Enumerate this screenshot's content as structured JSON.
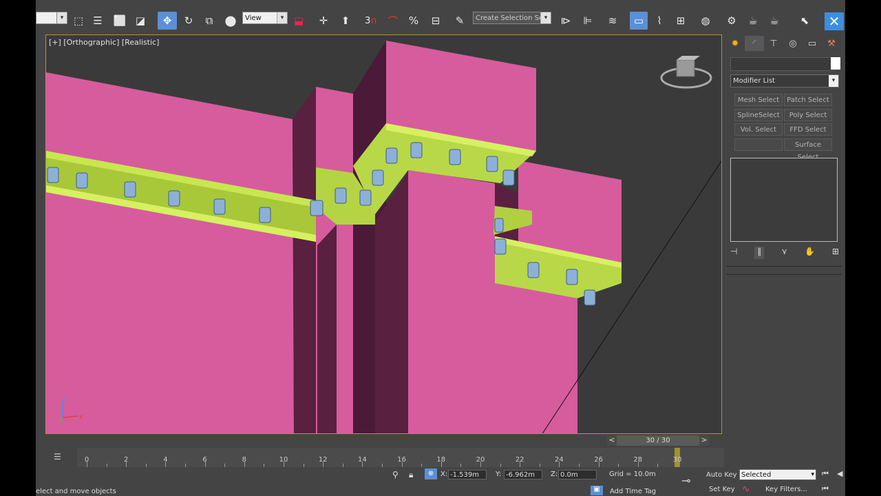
{
  "toolbar": {
    "selection_filter": "",
    "reference_coord": "View",
    "named_selection_placeholder": "Create Selection Se",
    "icons": [
      "select-object",
      "select-by-name",
      "rect-selection",
      "window-crossing",
      "move",
      "rotate",
      "scale",
      "select-manipulate",
      "pivot",
      "snaps-toggle",
      "angle-snap",
      "percent-snap",
      "spinner-snap",
      "edit-named-sets",
      "mirror",
      "align",
      "layer-manager",
      "graphite",
      "curve-editor",
      "schematic",
      "material-editor",
      "render-setup",
      "rendered-frame",
      "render",
      "render-iterative",
      "pin",
      "close"
    ]
  },
  "viewport": {
    "label": "[+] [Orthographic] [Realistic]",
    "axis": {
      "x": "x",
      "z": "z"
    }
  },
  "command_panel": {
    "modifier_list": "Modifier List",
    "buttons": [
      {
        "label": "Mesh Select"
      },
      {
        "label": "Patch Select"
      },
      {
        "label": "SplineSelect"
      },
      {
        "label": "Poly Select"
      },
      {
        "label": "Vol. Select"
      },
      {
        "label": "FFD Select"
      },
      {
        "label": ""
      },
      {
        "label": "Surface Select"
      }
    ]
  },
  "time_slider": {
    "label": "30 / 30",
    "prev": "<",
    "next": ">"
  },
  "timeline": {
    "ticks": [
      "0",
      "2",
      "4",
      "6",
      "8",
      "10",
      "12",
      "14",
      "16",
      "18",
      "20",
      "22",
      "24",
      "26",
      "28",
      "30"
    ],
    "current": 30
  },
  "status": {
    "prompt": "elect and move objects",
    "x_label": "X:",
    "x_value": "-1.539m",
    "y_label": "Y:",
    "y_value": "-6.962m",
    "z_label": "Z:",
    "z_value": "0.0m",
    "grid": "Grid = 10.0m",
    "add_time_tag": "Add Time Tag",
    "auto_key": "Auto Key",
    "set_key": "Set Key",
    "key_mode": "Selected",
    "key_filters": "Key Filters..."
  },
  "colors": {
    "accent": "#5b8fd6",
    "wall": "#d65c9e",
    "cornice": "#c3e04a",
    "bracket": "#8db0d8"
  }
}
